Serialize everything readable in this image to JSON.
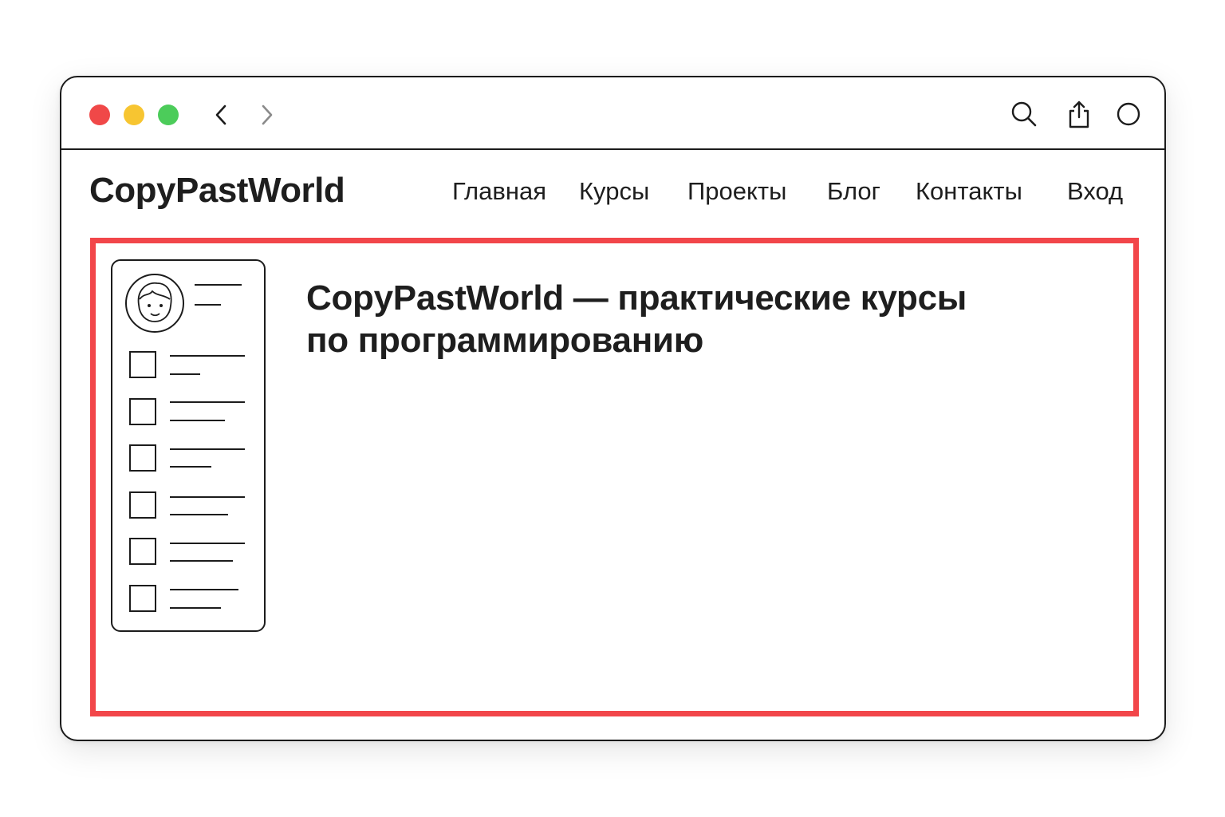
{
  "browser": {
    "traffic_lights": {
      "close_color": "#f04848",
      "minimize_color": "#f7c531",
      "maximize_color": "#4ccc5a"
    },
    "icons": {
      "back": "chevron-left-icon",
      "forward": "chevron-right-icon",
      "search": "search-icon",
      "share": "share-icon",
      "tabs": "circle-icon"
    }
  },
  "site": {
    "logo": "CopyPastWorld",
    "menu": [
      {
        "label": "Главная"
      },
      {
        "label": "Курсы"
      },
      {
        "label": "Проекты"
      },
      {
        "label": "Блог"
      },
      {
        "label": "Контакты"
      },
      {
        "label": "Вход"
      }
    ]
  },
  "hero": {
    "title_line1": "CopyPastWorld — практические курсы",
    "title_line2": "по программированию"
  },
  "highlight": {
    "color": "#f2464a"
  },
  "sidebar_card": {
    "avatar": "avatar-icon",
    "checkbox_items_count": 6
  }
}
